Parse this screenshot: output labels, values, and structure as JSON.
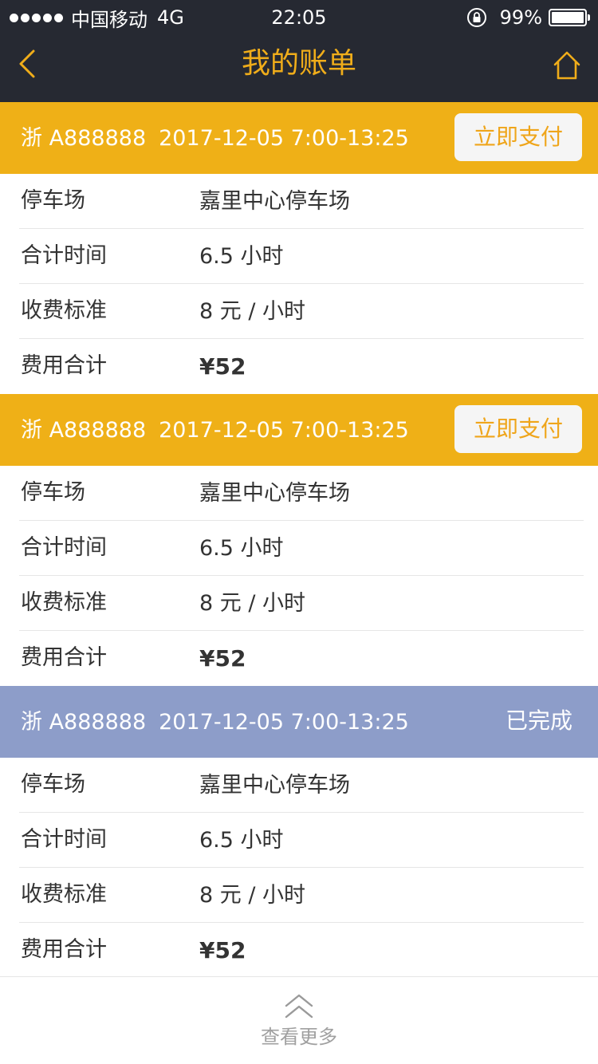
{
  "status_bar": {
    "carrier": "中国移动",
    "network": "4G",
    "time": "22:05",
    "battery": "99%"
  },
  "nav": {
    "title": "我的账单",
    "back_icon": "chevron-left-icon",
    "home_icon": "home-icon"
  },
  "colors": {
    "accent": "#efb017",
    "done": "#8d9dc9",
    "topbar": "#262932"
  },
  "bills": [
    {
      "plate": "浙 A888888",
      "time": "2017-12-05 7:00-13:25",
      "action_label": "立即支付",
      "status_label": "",
      "rows": [
        {
          "label": "停车场",
          "value": "嘉里中心停车场"
        },
        {
          "label": "合计时间",
          "value": "6.5 小时"
        },
        {
          "label": "收费标准",
          "value": "8 元 / 小时"
        },
        {
          "label": "费用合计",
          "value": "¥52"
        }
      ]
    },
    {
      "plate": "浙 A888888",
      "time": "2017-12-05 7:00-13:25",
      "action_label": "立即支付",
      "status_label": "",
      "rows": [
        {
          "label": "停车场",
          "value": "嘉里中心停车场"
        },
        {
          "label": "合计时间",
          "value": "6.5 小时"
        },
        {
          "label": "收费标准",
          "value": "8 元 / 小时"
        },
        {
          "label": "费用合计",
          "value": "¥52"
        }
      ]
    },
    {
      "plate": "浙 A888888",
      "time": "2017-12-05 7:00-13:25",
      "action_label": "",
      "status_label": "已完成",
      "rows": [
        {
          "label": "停车场",
          "value": "嘉里中心停车场"
        },
        {
          "label": "合计时间",
          "value": "6.5 小时"
        },
        {
          "label": "收费标准",
          "value": "8 元 / 小时"
        },
        {
          "label": "费用合计",
          "value": "¥52"
        }
      ]
    }
  ],
  "footer": {
    "more_label": "查看更多",
    "more_icon": "double-chevron-up-icon"
  }
}
